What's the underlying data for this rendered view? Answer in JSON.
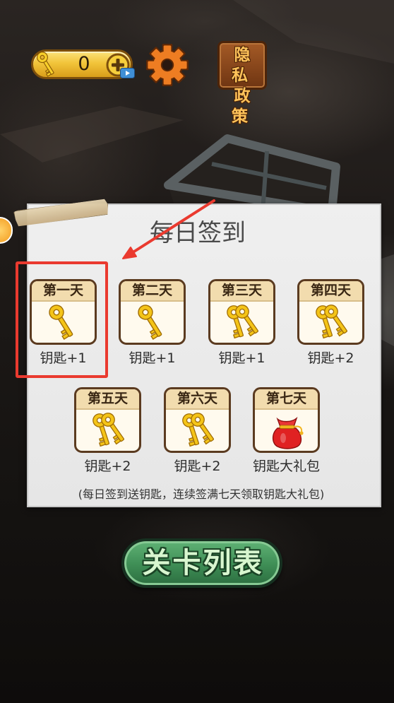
{
  "hud": {
    "key_icon": "key-icon",
    "key_count": "0",
    "add_keys_icon": "plus-icon",
    "video_ad_icon": "video-ad-icon",
    "settings_icon": "gear-icon",
    "privacy_button": {
      "line1": "隐私",
      "line2": "政策"
    }
  },
  "daily_signin": {
    "title": "每日签到",
    "days": [
      {
        "label": "第一天",
        "icon": "key-single",
        "reward": "钥匙+1"
      },
      {
        "label": "第二天",
        "icon": "key-single",
        "reward": "钥匙+1"
      },
      {
        "label": "第三天",
        "icon": "key-double",
        "reward": "钥匙+1"
      },
      {
        "label": "第四天",
        "icon": "key-double",
        "reward": "钥匙+2"
      },
      {
        "label": "第五天",
        "icon": "key-double",
        "reward": "钥匙+2"
      },
      {
        "label": "第六天",
        "icon": "key-double",
        "reward": "钥匙+2"
      },
      {
        "label": "第七天",
        "icon": "gift-bag",
        "reward": "钥匙大礼包"
      }
    ],
    "note": "(每日签到送钥匙，连续签满七天领取钥匙大礼包)"
  },
  "level_list_button": "关卡列表",
  "colors": {
    "highlight_red": "#ea3a2f",
    "key_gold": "#f4c418",
    "card_border": "#5b3b20",
    "card_header": "#f2dcae",
    "button_green": "#3e8d55",
    "gear_orange": "#ee7d22"
  }
}
